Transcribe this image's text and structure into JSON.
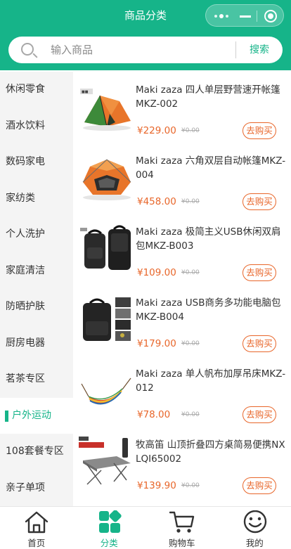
{
  "header": {
    "title": "商品分类",
    "capsule": {
      "more_icon": "more-dots-icon",
      "minimize_icon": "minimize-icon",
      "close_icon": "record-circle-icon"
    }
  },
  "search": {
    "placeholder": "输入商品",
    "value": "",
    "button_label": "搜索",
    "icon": "search-icon"
  },
  "sidebar": {
    "items": [
      {
        "label": "休闲零食",
        "active": false
      },
      {
        "label": "酒水饮料",
        "active": false
      },
      {
        "label": "数码家电",
        "active": false
      },
      {
        "label": "家纺类",
        "active": false
      },
      {
        "label": "个人洗护",
        "active": false
      },
      {
        "label": "家庭清洁",
        "active": false
      },
      {
        "label": "防晒护肤",
        "active": false
      },
      {
        "label": "厨房电器",
        "active": false
      },
      {
        "label": "茗茶专区",
        "active": false
      },
      {
        "label": "户外运动",
        "active": true
      },
      {
        "label": "108套餐专区",
        "active": false
      },
      {
        "label": "亲子单项",
        "active": false
      }
    ]
  },
  "products": [
    {
      "name": "Maki zaza 四人单层野营速开帐篷MKZ-002",
      "price": "¥229.00",
      "original_price": "¥0.00",
      "buy_label": "去购买",
      "image": "orange-green-tent"
    },
    {
      "name": "Maki zaza 六角双层自动帐篷MKZ-004",
      "price": "¥458.00",
      "original_price": "¥0.00",
      "buy_label": "去购买",
      "image": "hexagon-orange-tent"
    },
    {
      "name": "Maki zaza 极简主义USB休闲双肩包MKZ-B003",
      "price": "¥109.00",
      "original_price": "¥0.00",
      "buy_label": "去购买",
      "image": "black-backpack-pair"
    },
    {
      "name": "Maki zaza USB商务多功能电脑包MKZ-B004",
      "price": "¥179.00",
      "original_price": "¥0.00",
      "buy_label": "去购买",
      "image": "black-laptop-backpack"
    },
    {
      "name": "Maki zaza 单人帆布加厚吊床MKZ-012",
      "price": "¥78.00",
      "original_price": "¥0.00",
      "buy_label": "去购买",
      "image": "striped-hammock"
    },
    {
      "name": "牧高笛 山顶折叠四方桌简易便携NXLQI65002",
      "price": "¥139.90",
      "original_price": "¥0.00",
      "buy_label": "去购买",
      "image": "folding-table"
    }
  ],
  "tabbar": {
    "items": [
      {
        "label": "首页",
        "icon": "home-icon",
        "active": false
      },
      {
        "label": "分类",
        "icon": "category-grid-icon",
        "active": true
      },
      {
        "label": "购物车",
        "icon": "cart-icon",
        "active": false
      },
      {
        "label": "我的",
        "icon": "smiley-face-icon",
        "active": false
      }
    ]
  },
  "colors": {
    "brand": "#16b489",
    "price": "#e8662a",
    "sidebar_bg": "#f4f4f4"
  }
}
